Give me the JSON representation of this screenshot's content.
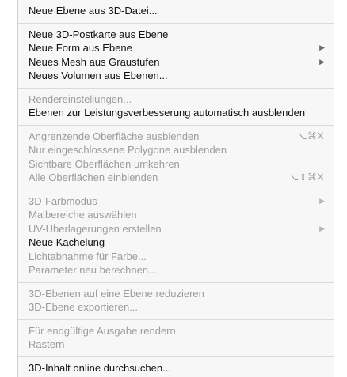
{
  "menu": {
    "groups": [
      {
        "items": [
          {
            "label": "Neue Ebene aus 3D-Datei...",
            "enabled": true
          }
        ]
      },
      {
        "items": [
          {
            "label": "Neue 3D-Postkarte aus Ebene",
            "enabled": true
          },
          {
            "label": "Neue Form aus Ebene",
            "enabled": true,
            "submenu": true
          },
          {
            "label": "Neues Mesh aus Graustufen",
            "enabled": true,
            "submenu": true
          },
          {
            "label": "Neues Volumen aus Ebenen...",
            "enabled": true
          }
        ]
      },
      {
        "items": [
          {
            "label": "Rendereinstellungen...",
            "enabled": false
          },
          {
            "label": "Ebenen zur Leistungsverbesserung automatisch ausblenden",
            "enabled": true
          }
        ]
      },
      {
        "items": [
          {
            "label": "Angrenzende Oberfläche ausblenden",
            "enabled": false,
            "shortcut": "⌥⌘X"
          },
          {
            "label": "Nur eingeschlossene Polygone ausblenden",
            "enabled": false
          },
          {
            "label": "Sichtbare Oberflächen umkehren",
            "enabled": false
          },
          {
            "label": "Alle Oberflächen einblenden",
            "enabled": false,
            "shortcut": "⌥⇧⌘X"
          }
        ]
      },
      {
        "items": [
          {
            "label": "3D-Farbmodus",
            "enabled": false,
            "submenu": true
          },
          {
            "label": "Malbereiche auswählen",
            "enabled": false
          },
          {
            "label": "UV-Überlagerungen erstellen",
            "enabled": false,
            "submenu": true
          },
          {
            "label": "Neue Kachelung",
            "enabled": true
          },
          {
            "label": "Lichtabnahme für Farbe...",
            "enabled": false
          },
          {
            "label": "Parameter neu berechnen...",
            "enabled": false
          }
        ]
      },
      {
        "items": [
          {
            "label": "3D-Ebenen auf eine Ebene reduzieren",
            "enabled": false
          },
          {
            "label": "3D-Ebene exportieren...",
            "enabled": false
          }
        ]
      },
      {
        "items": [
          {
            "label": "Für endgültige Ausgabe rendern",
            "enabled": false
          },
          {
            "label": "Rastern",
            "enabled": false
          }
        ]
      },
      {
        "items": [
          {
            "label": "3D-Inhalt online durchsuchen...",
            "enabled": true
          }
        ]
      }
    ],
    "submenu_arrow": "▶",
    "colors": {
      "enabled_text": "#111111",
      "disabled_text": "#9c9c9c",
      "background": "#f7f7f7",
      "separator": "#dadada"
    }
  }
}
